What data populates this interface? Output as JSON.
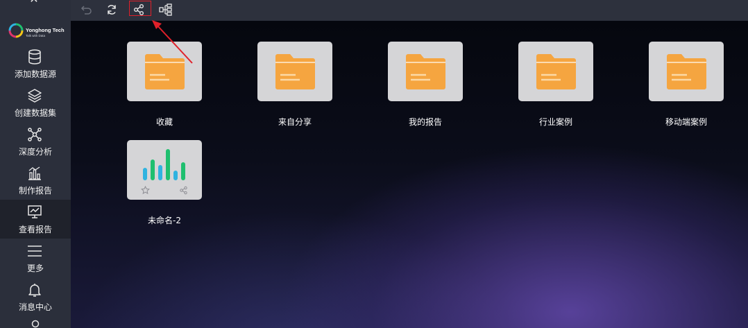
{
  "sidebar": {
    "logo_text": "Yonghong Tech",
    "logo_sub": "Talk with Data",
    "items": [
      {
        "label": "添加数据源"
      },
      {
        "label": "创建数据集"
      },
      {
        "label": "深度分析"
      },
      {
        "label": "制作报告"
      },
      {
        "label": "查看报告"
      },
      {
        "label": "更多"
      },
      {
        "label": "消息中心"
      }
    ],
    "active": "查看报告"
  },
  "toolbar": {
    "icons": [
      "undo-icon",
      "refresh-icon",
      "share-icon",
      "tree-structure-icon"
    ]
  },
  "folders": [
    {
      "label": "收藏"
    },
    {
      "label": "来自分享"
    },
    {
      "label": "我的报告"
    },
    {
      "label": "行业案例"
    },
    {
      "label": "移动端案例"
    }
  ],
  "reports": [
    {
      "label": "未命名-2"
    }
  ],
  "colors": {
    "sidebar_bg": "#2b2f3b",
    "topbar_bg": "#2d313d",
    "folder_orange": "#f5a540",
    "card_bg": "#d5d5d7",
    "bar_green": "#1fbf6f",
    "bar_blue": "#2fb3e0",
    "highlight_red": "#e0202a"
  }
}
